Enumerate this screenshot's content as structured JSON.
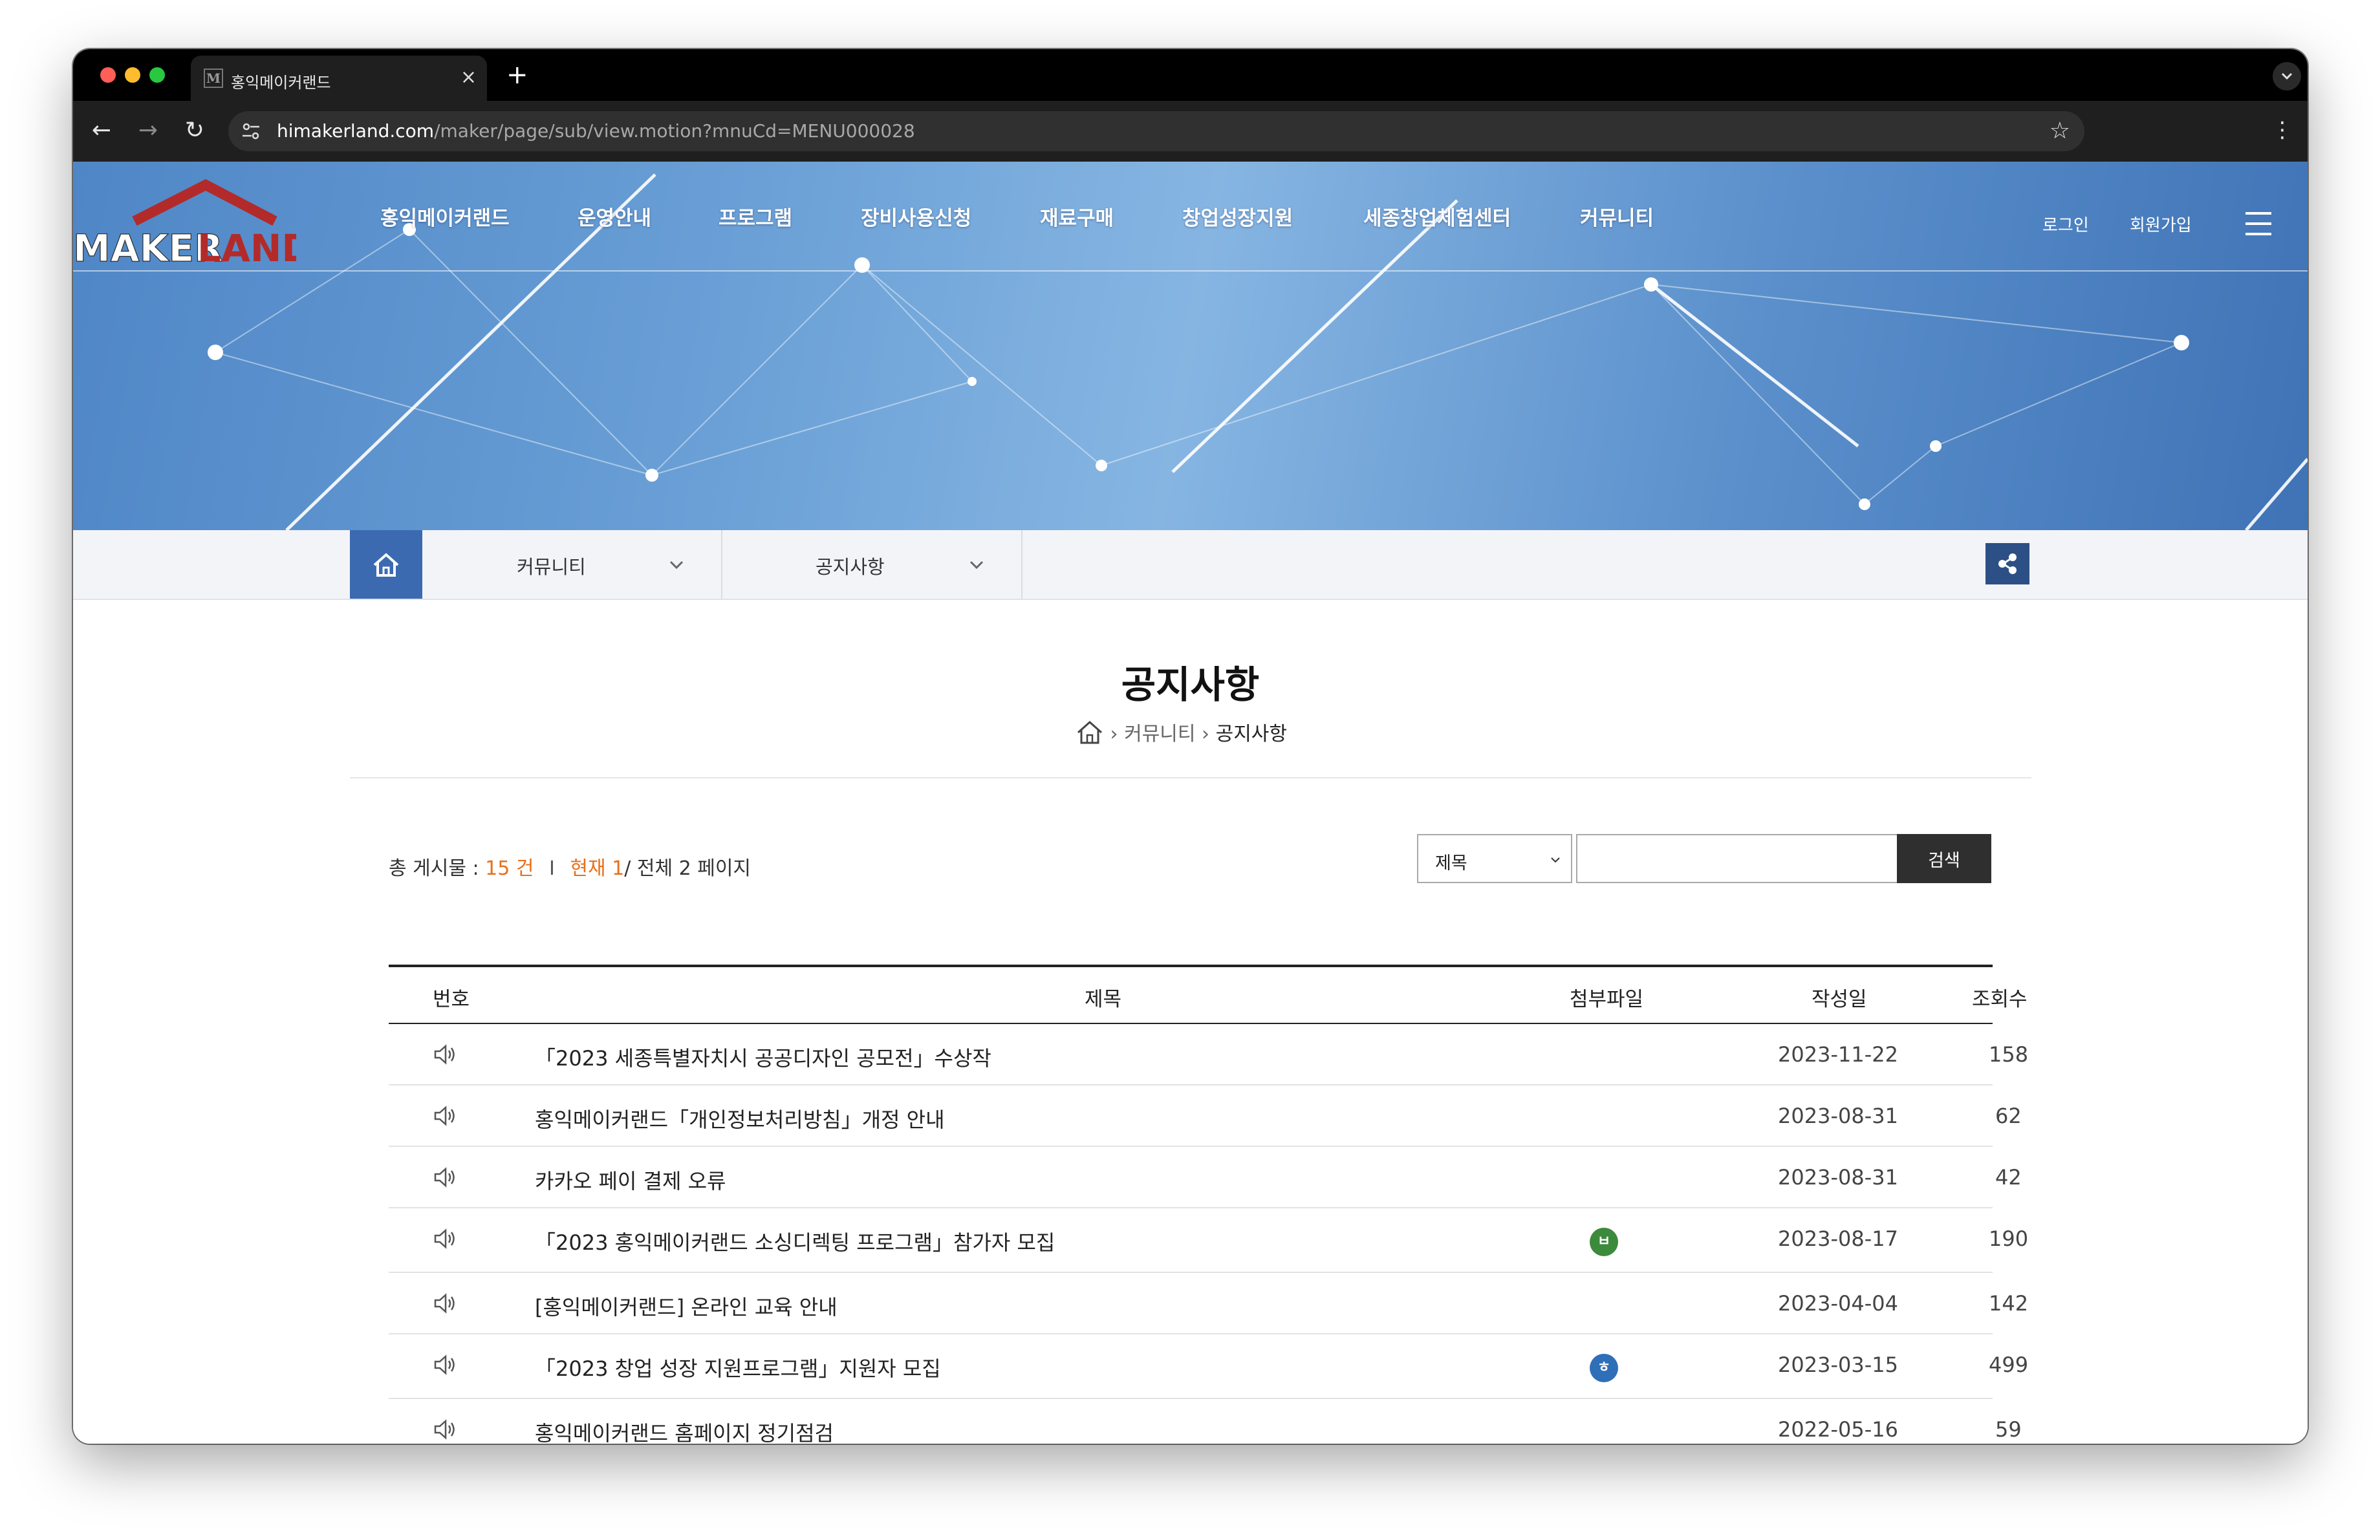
{
  "browser": {
    "tab_title": "홍익메이커랜드",
    "tab_favicon": "M",
    "url_host": "himakerland.com",
    "url_path": "/maker/page/sub/view.motion?mnuCd=MENU000028"
  },
  "site": {
    "logo_text_left": "MAKER",
    "logo_text_right": "LAND",
    "gnb": [
      "홍익메이커랜드",
      "운영안내",
      "프로그램",
      "장비사용신청",
      "재료구매",
      "창업성장지원",
      "세종창업체험센터",
      "커뮤니티"
    ],
    "login": "로그인",
    "signup": "회원가입"
  },
  "subnav": {
    "level1": "커뮤니티",
    "level2": "공지사항"
  },
  "page": {
    "title": "공지사항",
    "breadcrumb": [
      "커뮤니티",
      "공지사항"
    ]
  },
  "summary": {
    "total_label": "총 게시물 : ",
    "total_value": "15 건",
    "sep": "I",
    "current_label": "현재 1",
    "pages": "/ 전체 2 페이지"
  },
  "search": {
    "field_selected": "제목",
    "query": "",
    "button": "검색"
  },
  "table": {
    "headers": [
      "번호",
      "제목",
      "첨부파일",
      "작성일",
      "조회수"
    ],
    "rows": [
      {
        "title": "「2023 세종특별자치시 공공디자인 공모전」수상작",
        "attachment": "",
        "date": "2023-11-22",
        "views": "158"
      },
      {
        "title": "홍익메이커랜드「개인정보처리방침」개정 안내",
        "attachment": "",
        "date": "2023-08-31",
        "views": "62"
      },
      {
        "title": "카카오 페이 결제 오류",
        "attachment": "",
        "date": "2023-08-31",
        "views": "42"
      },
      {
        "title": "「2023 홍익메이커랜드 소싱디렉팅 프로그램」참가자 모집",
        "attachment": "hwp",
        "date": "2023-08-17",
        "views": "190"
      },
      {
        "title": "[홍익메이커랜드] 온라인 교육 안내",
        "attachment": "",
        "date": "2023-04-04",
        "views": "142"
      },
      {
        "title": "「2023 창업 성장 지원프로그램」지원자 모집",
        "attachment": "hwp",
        "date": "2023-03-15",
        "views": "499"
      },
      {
        "title": "홍익메이커랜드 홈페이지 정기점검",
        "attachment": "",
        "date": "2022-05-16",
        "views": "59"
      }
    ],
    "attachment_icons": {
      "hwp_green": "ㅂ",
      "hwp_blue": "ㅎ"
    }
  },
  "colors": {
    "accent_orange": "#e8701a",
    "nav_blue": "#3b6ab1",
    "share_blue": "#2c4f86",
    "logo_red": "#b32a2a"
  }
}
